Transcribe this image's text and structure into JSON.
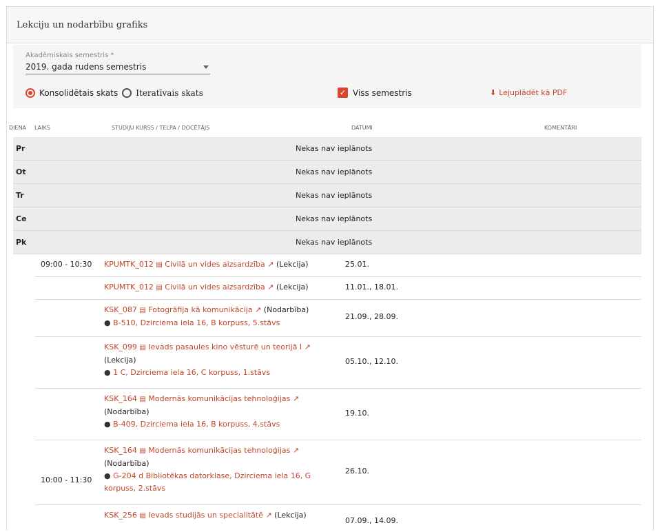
{
  "header": {
    "title": "Lekciju un nodarbību grafiks"
  },
  "filters": {
    "semester_label": "Akadēmiskais semestris *",
    "semester_value": "2019. gada rudens semestris",
    "radio_consolidated": "Konsolidētais skats",
    "radio_iterative": "Iteratīvais skats",
    "checkbox_label": "Viss semestris",
    "pdf_label": "Lejuplādēt kā PDF"
  },
  "columns": {
    "day": "DIENA",
    "time": "LAIKS",
    "course": "STUDIJU KURSS / TELPA / DOCĒTĀJS",
    "dates": "DATUMI",
    "comments": "KOMENTĀRI"
  },
  "days": [
    {
      "abbr": "Pr",
      "text": "Nekas nav ieplānots"
    },
    {
      "abbr": "Ot",
      "text": "Nekas nav ieplānots"
    },
    {
      "abbr": "Tr",
      "text": "Nekas nav ieplānots"
    },
    {
      "abbr": "Ce",
      "text": "Nekas nav ieplānots"
    },
    {
      "abbr": "Pk",
      "text": "Nekas nav ieplānots"
    }
  ],
  "lessons": [
    {
      "time": "09:00 - 10:30",
      "code": "KPUMTK_012",
      "name": "Civilā un vides aizsardzība",
      "type": "(Lekcija)",
      "location": "",
      "dates": "25.01."
    },
    {
      "time": "",
      "code": "KPUMTK_012",
      "name": "Civilā un vides aizsardzība",
      "type": "(Lekcija)",
      "location": "",
      "dates": "11.01., 18.01."
    },
    {
      "time": "",
      "code": "KSK_087",
      "name": "Fotogrāfija kā komunikācija",
      "type": "(Nodarbība)",
      "location": "B-510, Dzirciema iela 16, B korpuss, 5.stāvs",
      "dates": "21.09., 28.09."
    },
    {
      "time": "",
      "code": "KSK_099",
      "name": "Ievads pasaules kino vēsturē un teorijā I",
      "type": "(Lekcija)",
      "location": "1 C, Dzirciema iela 16, C korpuss, 1.stāvs",
      "dates": "05.10., 12.10."
    },
    {
      "time": "",
      "code": "KSK_164",
      "name": "Modernās komunikācijas tehnoloģijas",
      "type": "(Nodarbība)",
      "location": "B-409, Dzirciema iela 16, B korpuss, 4.stāvs",
      "dates": "19.10."
    },
    {
      "time": "10:00 - 11:30",
      "code": "KSK_164",
      "name": "Modernās komunikācijas tehnoloģijas",
      "type": "(Nodarbība)",
      "location": "G-204 d Bibliotēkas datorklase, Dzirciema iela 16, G korpuss, 2.stāvs",
      "dates": "26.10."
    },
    {
      "time": "",
      "code": "KSK_256",
      "name": "Ievads studijās un specialitātē",
      "type": "(Lekcija)",
      "location": "",
      "dates": "07.09., 14.09."
    }
  ],
  "icons": {
    "course": "list-icon",
    "external": "external-link-icon",
    "location": "map-pin-icon",
    "download": "download-icon",
    "accent": "#c0462a"
  }
}
